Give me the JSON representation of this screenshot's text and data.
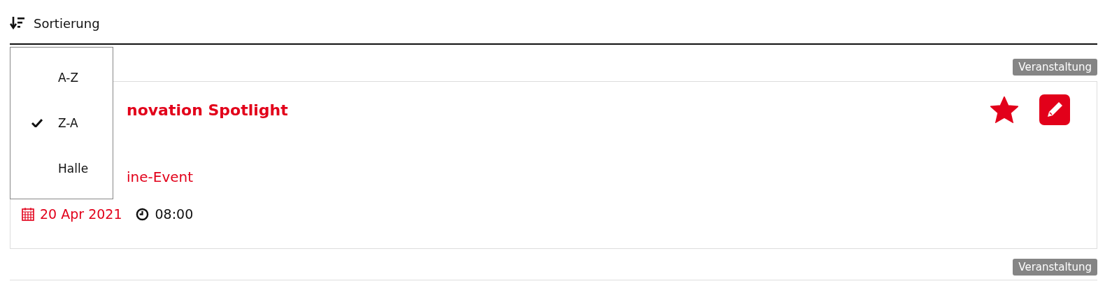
{
  "sort": {
    "label": "Sortierung",
    "options": [
      {
        "label": "A-Z",
        "selected": false
      },
      {
        "label": "Z-A",
        "selected": true
      },
      {
        "label": "Halle",
        "selected": false
      }
    ]
  },
  "events": [
    {
      "badge": "Veranstaltung",
      "title": "novation Spotlight",
      "location": "ine-Event",
      "date": "20 Apr 2021",
      "time": "08:00",
      "favorite": true
    }
  ],
  "next_badge": "Veranstaltung"
}
